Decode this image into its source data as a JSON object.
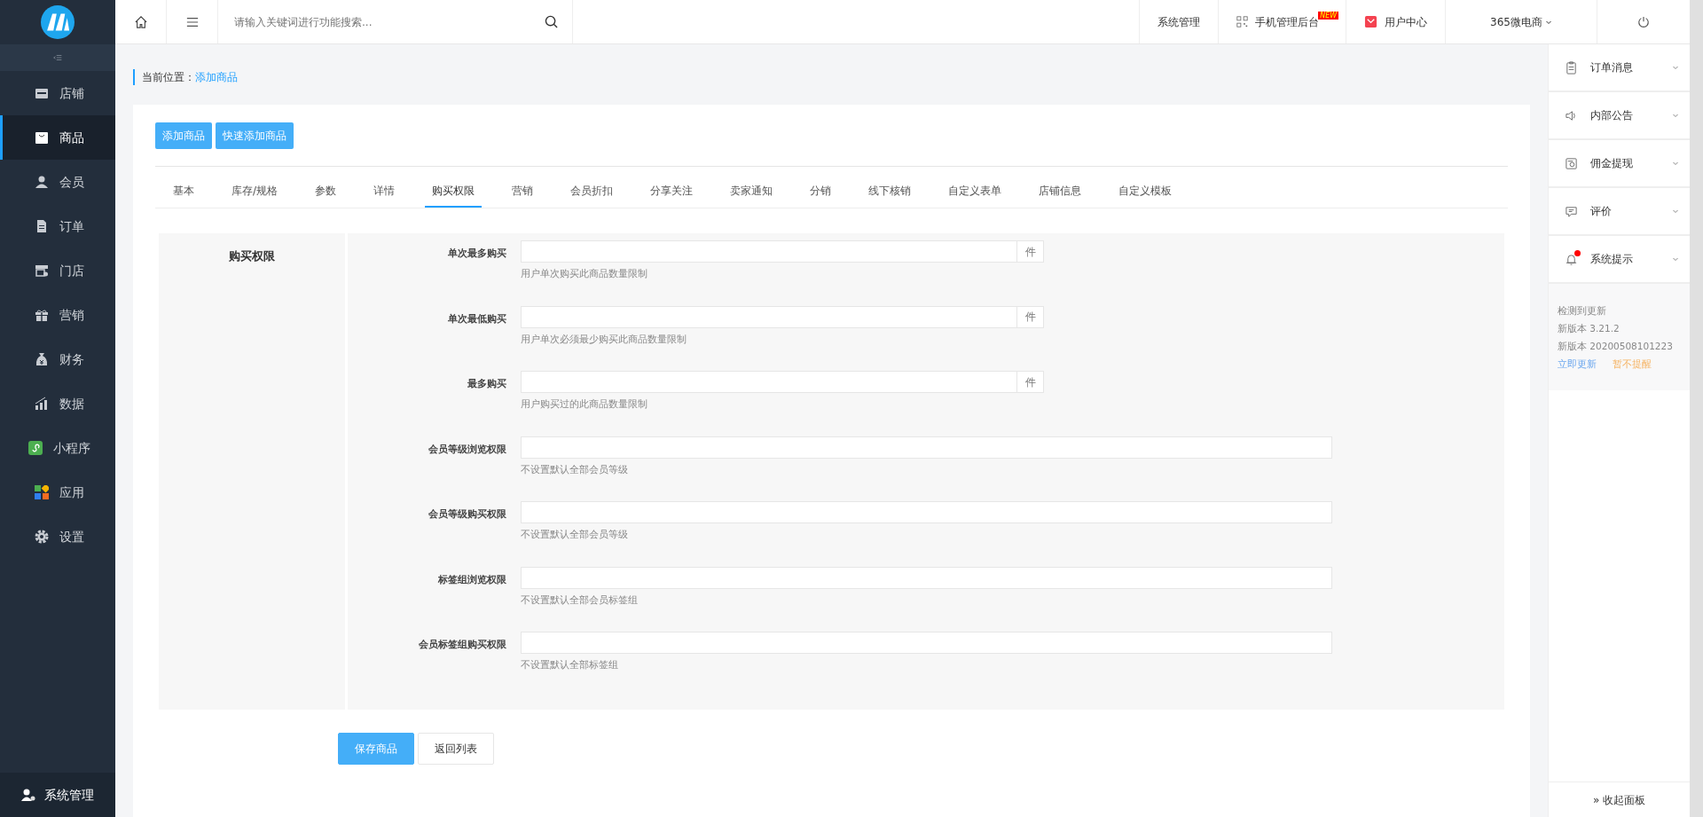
{
  "topbar": {
    "search": {
      "placeholder": "请输入关键词进行功能搜索..."
    },
    "links": [
      {
        "label": "系统管理",
        "kind": "text"
      },
      {
        "label": "手机管理后台",
        "kind": "mobile",
        "badge": "NEW"
      },
      {
        "label": "用户中心",
        "kind": "user"
      },
      {
        "label": "365微电商",
        "kind": "dropdown"
      },
      {
        "kind": "power"
      }
    ]
  },
  "sidebar": {
    "items": [
      {
        "label": "店铺",
        "selected": false
      },
      {
        "label": "商品",
        "selected": true
      },
      {
        "label": "会员",
        "selected": false
      },
      {
        "label": "订单",
        "selected": false
      },
      {
        "label": "门店",
        "selected": false
      },
      {
        "label": "营销",
        "selected": false
      },
      {
        "label": "财务",
        "selected": false
      },
      {
        "label": "数据",
        "selected": false
      },
      {
        "label": "小程序",
        "selected": false
      },
      {
        "label": "应用",
        "selected": false
      },
      {
        "label": "设置",
        "selected": false
      }
    ],
    "footer": "系统管理"
  },
  "breadcrumb": {
    "label": "当前位置：",
    "current": "添加商品"
  },
  "actions": [
    "添加商品",
    "快速添加商品"
  ],
  "tabs": [
    {
      "label": "基本",
      "selected": false
    },
    {
      "label": "库存/规格",
      "selected": false
    },
    {
      "label": "参数",
      "selected": false
    },
    {
      "label": "详情",
      "selected": false
    },
    {
      "label": "购买权限",
      "selected": true
    },
    {
      "label": "营销",
      "selected": false
    },
    {
      "label": "会员折扣",
      "selected": false
    },
    {
      "label": "分享关注",
      "selected": false
    },
    {
      "label": "卖家通知",
      "selected": false
    },
    {
      "label": "分销",
      "selected": false
    },
    {
      "label": "线下核销",
      "selected": false
    },
    {
      "label": "自定义表单",
      "selected": false
    },
    {
      "label": "店铺信息",
      "selected": false
    },
    {
      "label": "自定义模板",
      "selected": false
    }
  ],
  "section": {
    "title": "购买权限",
    "fields": [
      {
        "label": "单次最多购买",
        "unit": "件",
        "hint": "用户单次购买此商品数量限制"
      },
      {
        "label": "单次最低购买",
        "unit": "件",
        "hint": "用户单次必须最少购买此商品数量限制"
      },
      {
        "label": "最多购买",
        "unit": "件",
        "hint": "用户购买过的此商品数量限制"
      },
      {
        "label": "会员等级浏览权限",
        "hint": "不设置默认全部会员等级"
      },
      {
        "label": "会员等级购买权限",
        "hint": "不设置默认全部会员等级"
      },
      {
        "label": "标签组浏览权限",
        "hint": "不设置默认全部会员标签组"
      },
      {
        "label": "会员标签组购买权限",
        "hint": "不设置默认全部标签组"
      }
    ]
  },
  "footer_buttons": [
    {
      "label": "保存商品",
      "kind": "primary"
    },
    {
      "label": "返回列表",
      "kind": "default"
    }
  ],
  "right_panel": {
    "items": [
      {
        "label": "订单消息",
        "alert": false
      },
      {
        "label": "内部公告",
        "alert": false
      },
      {
        "label": "佣金提现",
        "alert": false
      },
      {
        "label": "评价",
        "alert": false
      },
      {
        "label": "系统提示",
        "alert": true
      }
    ],
    "update": {
      "lines": [
        "检测到更新",
        "新版本 3.21.2",
        "新版本 20200508101223"
      ],
      "update_link": "立即更新",
      "ignore_link": "暂不提醒"
    },
    "collapse": "» 收起面板"
  }
}
